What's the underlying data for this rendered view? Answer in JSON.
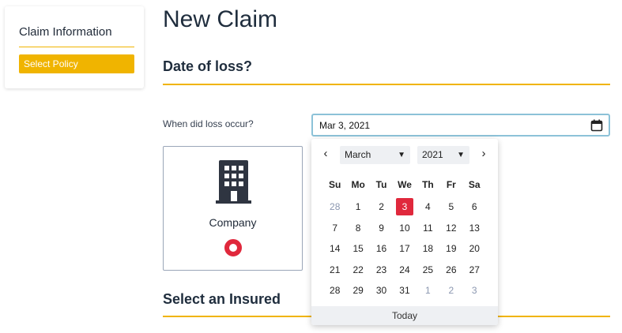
{
  "sidebar": {
    "title": "Claim Information",
    "select_policy_label": "Select Policy"
  },
  "page": {
    "title": "New Claim"
  },
  "sections": {
    "date_of_loss": "Date of loss?",
    "select_insured": "Select an Insured"
  },
  "form": {
    "loss_date_label": "When did loss occur?",
    "loss_date_value": "Mar 3, 2021"
  },
  "insured_option": {
    "label": "Company",
    "icon": "building-icon",
    "selected": true
  },
  "datepicker": {
    "prev_label": "‹",
    "next_label": "›",
    "month": "March",
    "year": "2021",
    "weekdays": [
      "Su",
      "Mo",
      "Tu",
      "We",
      "Th",
      "Fr",
      "Sa"
    ],
    "weeks": [
      [
        {
          "d": "28",
          "o": true
        },
        {
          "d": "1"
        },
        {
          "d": "2"
        },
        {
          "d": "3",
          "s": true
        },
        {
          "d": "4"
        },
        {
          "d": "5"
        },
        {
          "d": "6"
        }
      ],
      [
        {
          "d": "7"
        },
        {
          "d": "8"
        },
        {
          "d": "9"
        },
        {
          "d": "10"
        },
        {
          "d": "11"
        },
        {
          "d": "12"
        },
        {
          "d": "13"
        }
      ],
      [
        {
          "d": "14"
        },
        {
          "d": "15"
        },
        {
          "d": "16"
        },
        {
          "d": "17"
        },
        {
          "d": "18"
        },
        {
          "d": "19"
        },
        {
          "d": "20"
        }
      ],
      [
        {
          "d": "21"
        },
        {
          "d": "22"
        },
        {
          "d": "23"
        },
        {
          "d": "24"
        },
        {
          "d": "25"
        },
        {
          "d": "26"
        },
        {
          "d": "27"
        }
      ],
      [
        {
          "d": "28"
        },
        {
          "d": "29"
        },
        {
          "d": "30"
        },
        {
          "d": "31"
        },
        {
          "d": "1",
          "o": true
        },
        {
          "d": "2",
          "o": true
        },
        {
          "d": "3",
          "o": true
        }
      ]
    ],
    "today_label": "Today"
  },
  "colors": {
    "accent": "#f0b400",
    "selected": "#e0283c",
    "input_focus_border": "#8cc2d8",
    "title_text": "#1f2d3d"
  }
}
